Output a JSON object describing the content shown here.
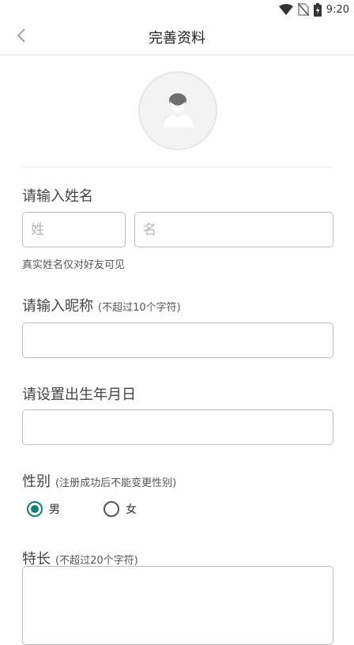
{
  "status_bar": {
    "time": "9:20"
  },
  "header": {
    "title": "完善资料"
  },
  "name_section": {
    "label": "请输入姓名",
    "last_name_placeholder": "姓",
    "first_name_placeholder": "名",
    "note": "真实姓名仅对好友可见"
  },
  "nickname_section": {
    "label": "请输入昵称",
    "hint": "(不超过10个字符)",
    "value": ""
  },
  "birthday_section": {
    "label": "请设置出生年月日",
    "value": ""
  },
  "gender_section": {
    "label": "性别",
    "hint": "(注册成功后不能变更性别)",
    "options": [
      {
        "label": "男",
        "selected": true
      },
      {
        "label": "女",
        "selected": false
      }
    ]
  },
  "specialty_section": {
    "label": "特长",
    "hint": "(不超过20个字符)",
    "value": ""
  },
  "colors": {
    "accent": "#10806f"
  }
}
